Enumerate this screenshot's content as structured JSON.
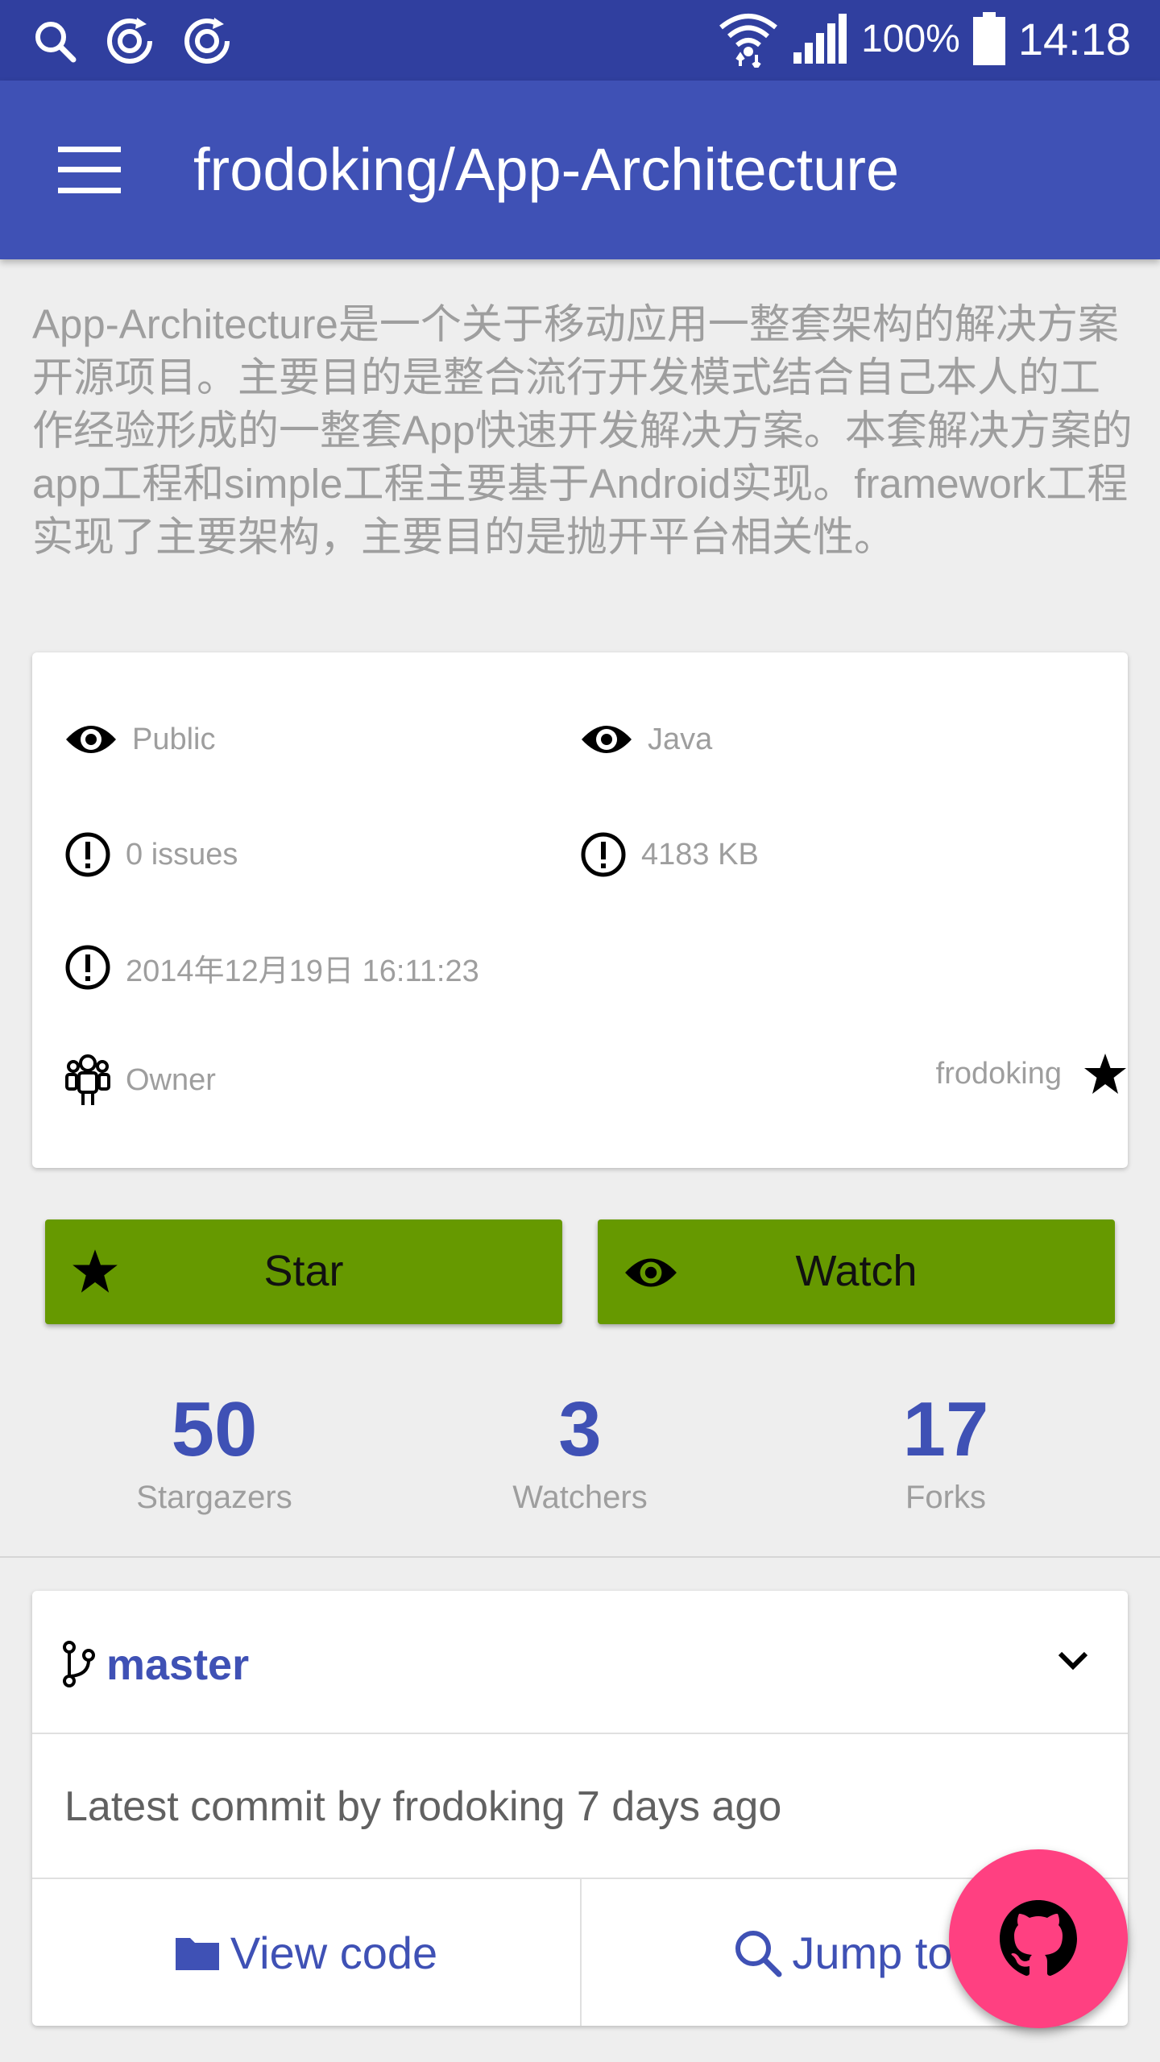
{
  "status_bar": {
    "battery": "100%",
    "time": "14:18",
    "left_icons": [
      "search-icon",
      "sync-icon",
      "sync-icon"
    ],
    "right_icons": [
      "wifi-icon",
      "signal-icon",
      "battery-icon"
    ]
  },
  "app_bar": {
    "title": "frodoking/App-Architecture",
    "menu_icon": "menu-icon"
  },
  "description": "App-Architecture是一个关于移动应用一整套架构的解决方案开源项目。主要目的是整合流行开发模式结合自己本人的工作经验形成的一整套App快速开发解决方案。本套解决方案的app工程和simple工程主要基于Android实现。framework工程实现了主要架构，主要目的是抛开平台相关性。",
  "info": {
    "visibility": "Public",
    "language": "Java",
    "issues": "0 issues",
    "size": "4183 KB",
    "date": "2014年12月19日 16:11:23",
    "owner_label": "Owner",
    "owner_name": "frodoking"
  },
  "actions": {
    "star_label": "Star",
    "watch_label": "Watch"
  },
  "stats": {
    "stargazers_count": "50",
    "stargazers_label": "Stargazers",
    "watchers_count": "3",
    "watchers_label": "Watchers",
    "forks_count": "17",
    "forks_label": "Forks"
  },
  "branch": {
    "name": "master",
    "latest_commit": "Latest commit by frodoking 7 days ago",
    "view_code_label": "View code",
    "jump_to_label": "Jump to f"
  },
  "colors": {
    "status_bar": "#303f9f",
    "primary": "#3f51b5",
    "button_green": "#669900",
    "fab_pink": "#ff4081",
    "background": "#eeeeee"
  }
}
